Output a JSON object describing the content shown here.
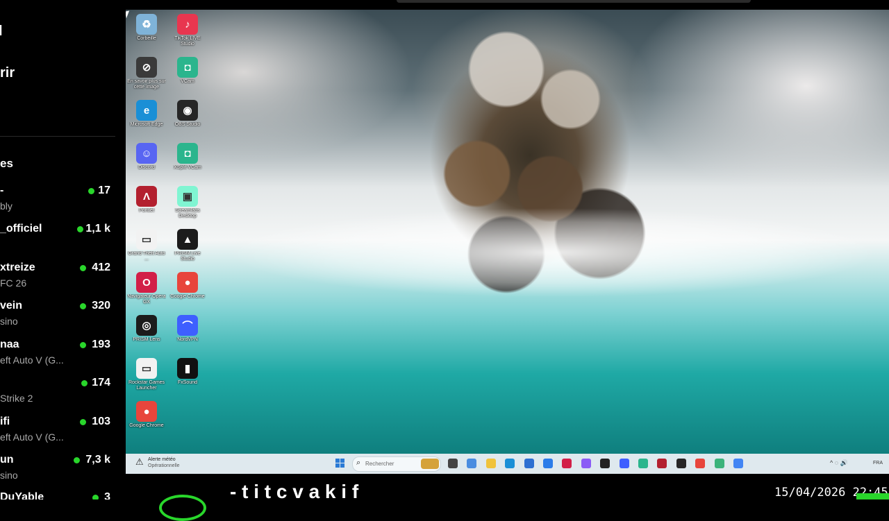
{
  "sidebar": {
    "top_line1": "l",
    "top_line2": "rir",
    "section_title": "es",
    "channels": [
      {
        "name": "-",
        "game": "bly",
        "viewers": "17"
      },
      {
        "name": "_officiel",
        "game": "",
        "viewers": "1,1 k"
      },
      {
        "name": "xtreize",
        "game": "FC 26",
        "viewers": "412"
      },
      {
        "name": "vein",
        "game": "sino",
        "viewers": "320"
      },
      {
        "name": "naa",
        "game": "eft Auto V (G...",
        "viewers": "193"
      },
      {
        "name": "",
        "game": "Strike 2",
        "viewers": "174"
      },
      {
        "name": "ifi",
        "game": "eft Auto V (G...",
        "viewers": "103"
      },
      {
        "name": "un",
        "game": "sino",
        "viewers": "7,3 k"
      },
      {
        "name": "DuYable",
        "game": "",
        "viewers": "3"
      }
    ],
    "live_color": "#29d62b"
  },
  "desktop": {
    "icons": [
      {
        "label": "Corbeille",
        "icon": "recycle-bin-icon",
        "color": "#7fb3d8",
        "glyph": "♻"
      },
      {
        "label": "TikTok LIVE Studio",
        "icon": "tiktok-live-studio-icon",
        "color": "#e8364f",
        "glyph": "♪"
      },
      {
        "label": "En savoir plus sur cette image",
        "icon": "spotlight-info-icon",
        "color": "#3a3a3a",
        "glyph": "⊘"
      },
      {
        "label": "VCam",
        "icon": "vcam-icon",
        "color": "#2bb58d",
        "glyph": "◘"
      },
      {
        "label": "Microsoft Edge",
        "icon": "edge-icon",
        "color": "#1a8fd6",
        "glyph": "e"
      },
      {
        "label": "OBS Studio",
        "icon": "obs-icon",
        "color": "#262626",
        "glyph": "◉"
      },
      {
        "label": "Discord",
        "icon": "discord-icon",
        "color": "#5865f2",
        "glyph": "☺"
      },
      {
        "label": "XSplit VCam",
        "icon": "xsplit-vcam-icon",
        "color": "#2bb58d",
        "glyph": "◘"
      },
      {
        "label": "Pontlet",
        "icon": "pontlet-icon",
        "color": "#b3202f",
        "glyph": "Λ"
      },
      {
        "label": "Streamlabs Desktop",
        "icon": "streamlabs-icon",
        "color": "#80f5d2",
        "glyph": "▣"
      },
      {
        "label": "Grand Theft Auto ...",
        "icon": "document-icon",
        "color": "#f2f2f2",
        "glyph": "▭"
      },
      {
        "label": "PRISM Live Studio",
        "icon": "prism-live-icon",
        "color": "#1c1c1c",
        "glyph": "▲"
      },
      {
        "label": "Navigateur Opera GX",
        "icon": "opera-gx-icon",
        "color": "#d21f48",
        "glyph": "O"
      },
      {
        "label": "Google Chrome",
        "icon": "chrome-icon",
        "color": "#e8453c",
        "glyph": "●"
      },
      {
        "label": "PRISM Lens",
        "icon": "prism-lens-icon",
        "color": "#1c1c1c",
        "glyph": "◎"
      },
      {
        "label": "NordVPN",
        "icon": "nordvpn-icon",
        "color": "#3e5fff",
        "glyph": "⌒"
      },
      {
        "label": "Rockstar Games Launcher",
        "icon": "document-icon",
        "color": "#f2f2f2",
        "glyph": "▭"
      },
      {
        "label": "FxSound",
        "icon": "fxsound-icon",
        "color": "#111111",
        "glyph": "▮"
      },
      {
        "label": "Google Chrome",
        "icon": "chrome-icon",
        "color": "#e8453c",
        "glyph": "●"
      }
    ]
  },
  "taskbar": {
    "weather_title": "Alerte météo",
    "weather_sub": "Opérationnelle",
    "search_placeholder": "Rechercher",
    "apps": [
      {
        "icon": "task-view-icon",
        "color": "#444444"
      },
      {
        "icon": "copilot-icon",
        "color": "#4a8de0"
      },
      {
        "icon": "file-explorer-icon",
        "color": "#f0c33c"
      },
      {
        "icon": "edge-icon",
        "color": "#1a8fd6"
      },
      {
        "icon": "store-icon",
        "color": "#2d6fd1"
      },
      {
        "icon": "mail-icon",
        "color": "#2b7ce9"
      },
      {
        "icon": "opera-gx-icon",
        "color": "#d21f48"
      },
      {
        "icon": "messenger-icon",
        "color": "#8b5cf6"
      },
      {
        "icon": "capcut-icon",
        "color": "#222222"
      },
      {
        "icon": "nordvpn-icon",
        "color": "#3e5fff"
      },
      {
        "icon": "vcam-icon",
        "color": "#2bb58d"
      },
      {
        "icon": "pontlet-icon",
        "color": "#b3202f"
      },
      {
        "icon": "obs-icon",
        "color": "#262626"
      },
      {
        "icon": "chrome-icon",
        "color": "#e8453c"
      },
      {
        "icon": "streamlabs-icon",
        "color": "#3bb37b"
      },
      {
        "icon": "chrome-icon",
        "color": "#4285f4"
      }
    ],
    "tray": "^  ◌  🔊",
    "language": "FRA"
  },
  "bottom": {
    "text": "- t  i  t  c  v  a  k  i  f",
    "clock": "15/04/2026 22:45"
  }
}
